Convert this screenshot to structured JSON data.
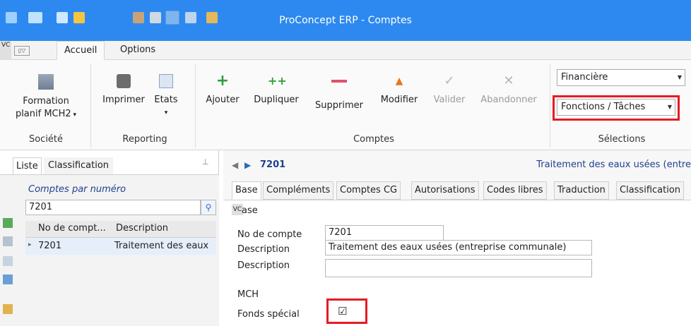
{
  "window": {
    "title": "ProConcept ERP - Comptes"
  },
  "ribbon_tabs": [
    {
      "label": "Accueil"
    },
    {
      "label": "Options"
    }
  ],
  "vc_badge": "VC",
  "ribbon": {
    "societe": {
      "button_line1": "Formation",
      "button_line2": "planif MCH2",
      "group": "Société"
    },
    "reporting": {
      "print": "Imprimer",
      "states": "Etats",
      "group": "Reporting"
    },
    "comptes": {
      "add": "Ajouter",
      "duplicate": "Dupliquer",
      "delete": "Supprimer",
      "modify": "Modifier",
      "validate": "Valider",
      "cancel": "Abandonner",
      "group": "Comptes"
    },
    "selections": {
      "combo1": "Financière",
      "combo2": "Fonctions / Tâches",
      "group": "Sélections"
    }
  },
  "left": {
    "tabs": [
      {
        "label": "Liste"
      },
      {
        "label": "Classification"
      }
    ],
    "list_title": "Comptes par numéro",
    "search_value": "7201",
    "columns": [
      "No de compt...",
      "Description"
    ],
    "rows": [
      {
        "num": "7201",
        "desc": "Traitement des eaux"
      }
    ],
    "pin": "ᵖ"
  },
  "right": {
    "account_number": "7201",
    "account_title": "Traitement des eaux usées (entre",
    "tabs": [
      {
        "label": "Base"
      },
      {
        "label": "Compléments"
      },
      {
        "label": "Comptes CG"
      },
      {
        "label": "Autorisations"
      },
      {
        "label": "Codes libres"
      },
      {
        "label": "Traduction"
      },
      {
        "label": "Classification"
      }
    ],
    "base_badge": "VC",
    "base_label": "ase",
    "fields": {
      "num_label": "No de compte",
      "num_value": "7201",
      "desc_label": "Description",
      "desc_value": "Traitement des eaux usées (entreprise communale)",
      "desc2_label": "Description",
      "desc2_value": "",
      "section": "MCH",
      "fund_label": "Fonds spécial",
      "fund_checked": "☑"
    }
  },
  "colors": {
    "titlebar": "#2d89ef",
    "highlight": "#e51c23",
    "link": "#1f3f8f"
  }
}
